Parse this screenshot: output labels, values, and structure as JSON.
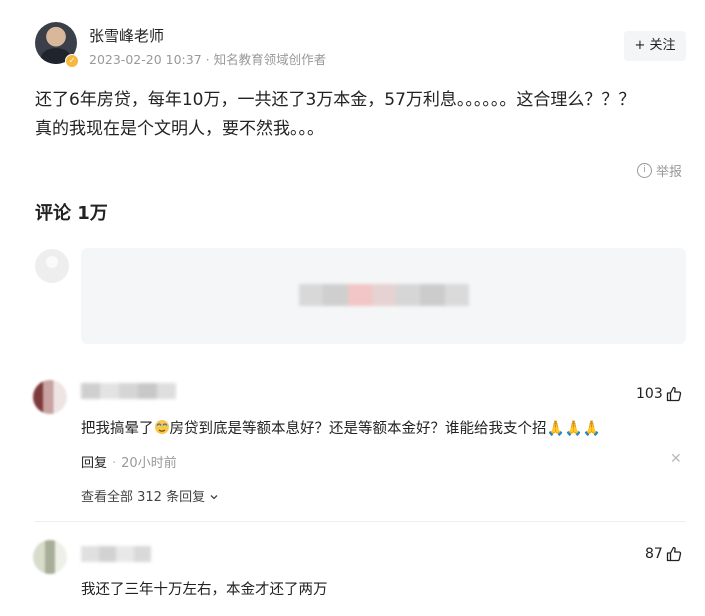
{
  "author": {
    "name": "张雪峰老师",
    "date": "2023-02-20 10:37",
    "title": "知名教育领域创作者",
    "follow_label": "+ 关注"
  },
  "post": {
    "line1": "还了6年房贷，每年10万，一共还了3万本金，57万利息。。。。。。这合理么？？？",
    "line2": "真的我现在是个文明人，要不然我。。。",
    "report_label": "举报"
  },
  "comments_header": "评论 1万",
  "comments": [
    {
      "likes": "103",
      "text_before": "把我搞晕了",
      "text_after": "房贷到底是等额本息好？还是等额本金好？谁能给我支个招🙏🙏🙏",
      "reply_label": "回复",
      "time": "20小时前",
      "see_all_replies": "查看全部 312 条回复"
    },
    {
      "likes": "87",
      "text": "我还了三年十万左右，本金才还了两万"
    }
  ],
  "icons": {
    "verified": "verified-badge-icon",
    "info": "info-circle-icon",
    "like": "thumbs-up-icon",
    "close": "close-icon",
    "chevron": "chevron-down-icon"
  }
}
